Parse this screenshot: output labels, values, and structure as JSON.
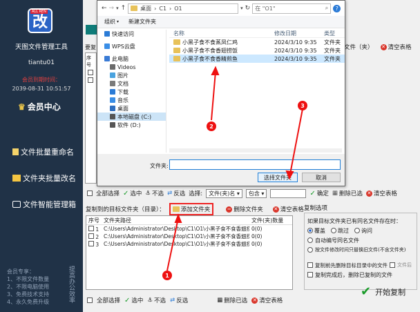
{
  "sidebar": {
    "logo_char": "改",
    "logo_tag": "ALL REN",
    "app_name": "天图文件管理工具",
    "user_name": "tiantu01",
    "member_expire_label": "会员到期时间：",
    "expire_time": "2039-08-31 10:51:57",
    "member_center": "会员中心",
    "nav": [
      "文件批量重命名",
      "文件夹批量改名",
      "文件智能管理箱"
    ],
    "promo": [
      "会员专享：",
      "1、不限文件数量",
      "2、不限电脑使用",
      "3、免费技术支持",
      "4、永久免费升级"
    ],
    "slogan": "提高办公效率"
  },
  "main": {
    "top_list_label": "要复",
    "top_list_col": "序号",
    "top_toolbar": {
      "delete_folder": "文件（夹）",
      "clear_table": "清空表格"
    },
    "filter_bar": {
      "select_all": "全部选择",
      "select": "选中",
      "unselect": "不选",
      "invert": "反选",
      "filter_label": "选择:",
      "filter_field": "文件(夹)名",
      "filter_op": "包含",
      "confirm": "确定",
      "delete_selected": "删除已选",
      "clear_table": "清空表格"
    },
    "copy_target": {
      "label": "复制到的目标文件夹（目录）：",
      "add_folder": "添加文件夹",
      "delete_folder": "删除文件夹",
      "clear_table": "清空表格",
      "columns": [
        "序号",
        "文件夹路径",
        "文件(夹)数量"
      ],
      "rows": [
        {
          "no": "1",
          "path": "C:\\Users\\Administrator\\Desktop\\C1\\O1\\小黑子食不食香翅捞饭",
          "count": "0(0)"
        },
        {
          "no": "2",
          "path": "C:\\Users\\Administrator\\Desktop\\C1\\O1\\小黑子食不食香翅捞饭",
          "count": "0(0)"
        },
        {
          "no": "3",
          "path": "C:\\Users\\Administrator\\Desktop\\C1\\O1\\小黑子食不食香翅捞饭",
          "count": "0(0)"
        }
      ]
    },
    "copy_options": {
      "title": "复制选项",
      "question": "如果目标文件夹已有同名文件存在时：",
      "radios": [
        "覆盖",
        "跳过",
        "询问"
      ],
      "auto_number": "自动编号同名文件",
      "keep_time": "按文件修改时间只替换旧文件(不含文件夹)",
      "clear_before": "复制前先删除目标目录中的文件",
      "suffix_label": "文件后",
      "delete_after": "复制完成后，删除已复制的文件"
    },
    "bottom_bar": {
      "select_all": "全部选择",
      "select": "选中",
      "unselect": "不选",
      "invert": "反选",
      "delete_selected": "删除已选",
      "clear_table": "清空表格"
    },
    "start_copy": "开始复制"
  },
  "dialog": {
    "address": [
      "桌面",
      "C1",
      "O1"
    ],
    "search_placeholder": "在 \"O1\"",
    "toolbar": [
      "组织",
      "新建文件夹"
    ],
    "nav": [
      {
        "label": "快速访问",
        "icon": "star-icon",
        "level": "top",
        "color": "#2b7bd6"
      },
      {
        "label": "WPS云盘",
        "icon": "cloud-icon",
        "level": "top",
        "color": "#3a8ee6"
      },
      {
        "label": "此电脑",
        "icon": "computer-icon",
        "level": "top",
        "color": "#3a7bd5"
      },
      {
        "label": "Videos",
        "icon": "video-icon",
        "level": "sub",
        "color": "#6a6a6a"
      },
      {
        "label": "图片",
        "icon": "picture-icon",
        "level": "sub",
        "color": "#4aa3df"
      },
      {
        "label": "文档",
        "icon": "document-icon",
        "level": "sub",
        "color": "#7a7a7a"
      },
      {
        "label": "下载",
        "icon": "download-icon",
        "level": "sub",
        "color": "#2b7bd6"
      },
      {
        "label": "音乐",
        "icon": "music-icon",
        "level": "sub",
        "color": "#3a8ee6"
      },
      {
        "label": "桌面",
        "icon": "desktop-icon",
        "level": "sub",
        "color": "#2f6fc0"
      },
      {
        "label": "本地磁盘 (C:)",
        "icon": "drive-icon",
        "level": "sub",
        "color": "#555555",
        "selected": true
      },
      {
        "label": "软件 (D:)",
        "icon": "drive-icon",
        "level": "sub",
        "color": "#555555"
      }
    ],
    "columns": [
      "名称",
      "修改日期",
      "类型"
    ],
    "files": [
      {
        "name": "小黑子食不食蒸凤仁鸡",
        "date": "2024/3/10 9:35",
        "type": "文件夹"
      },
      {
        "name": "小黑子食不食香翅捞饭",
        "date": "2024/3/10 9:35",
        "type": "文件夹"
      },
      {
        "name": "小黑子食不食香精煎鱼",
        "date": "2024/3/10 9:35",
        "type": "文件夹",
        "selected": true
      }
    ],
    "folder_label": "文件夹:",
    "select_button": "选择文件夹",
    "cancel_button": "取消"
  },
  "annotations": [
    "1",
    "2",
    "3"
  ]
}
